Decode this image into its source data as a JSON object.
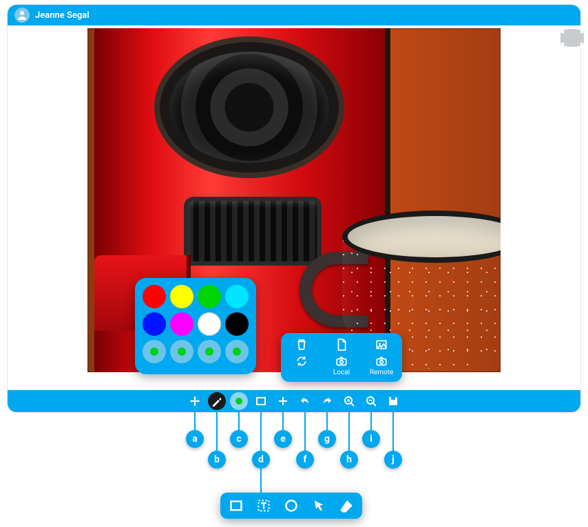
{
  "header": {
    "username": "Jeanne Segal"
  },
  "palette": {
    "row1": [
      "#ff0000",
      "#ffff00",
      "#00d400",
      "#00e4ff"
    ],
    "row2": [
      "#0015ff",
      "#ff00ff",
      "#ffffff",
      "#000000"
    ],
    "recent": [
      "#00d01e",
      "#00d01e",
      "#00d01e",
      "#00d01e"
    ]
  },
  "file_popup": {
    "local_label": "Local",
    "remote_label": "Remote"
  },
  "toolbar": {
    "items": [
      {
        "key": "a",
        "name": "move",
        "icon": "move"
      },
      {
        "key": "b",
        "name": "draw",
        "icon": "pencil"
      },
      {
        "key": "c",
        "name": "color",
        "icon": "dot"
      },
      {
        "key": "d",
        "name": "shape",
        "icon": "rect"
      },
      {
        "key": "e",
        "name": "add",
        "icon": "plus"
      },
      {
        "key": "f",
        "name": "undo",
        "icon": "undo"
      },
      {
        "key": "g",
        "name": "redo",
        "icon": "redo"
      },
      {
        "key": "h",
        "name": "zoomin",
        "icon": "zoom-in"
      },
      {
        "key": "i",
        "name": "zoomout",
        "icon": "zoom-out"
      },
      {
        "key": "j",
        "name": "save",
        "icon": "save"
      }
    ]
  },
  "shapes": [
    "rect",
    "text",
    "circle",
    "pointer",
    "eraser"
  ],
  "labels": {
    "a": "a",
    "b": "b",
    "c": "c",
    "d": "d",
    "e": "e",
    "f": "f",
    "g": "g",
    "h": "h",
    "i": "i",
    "j": "j"
  }
}
